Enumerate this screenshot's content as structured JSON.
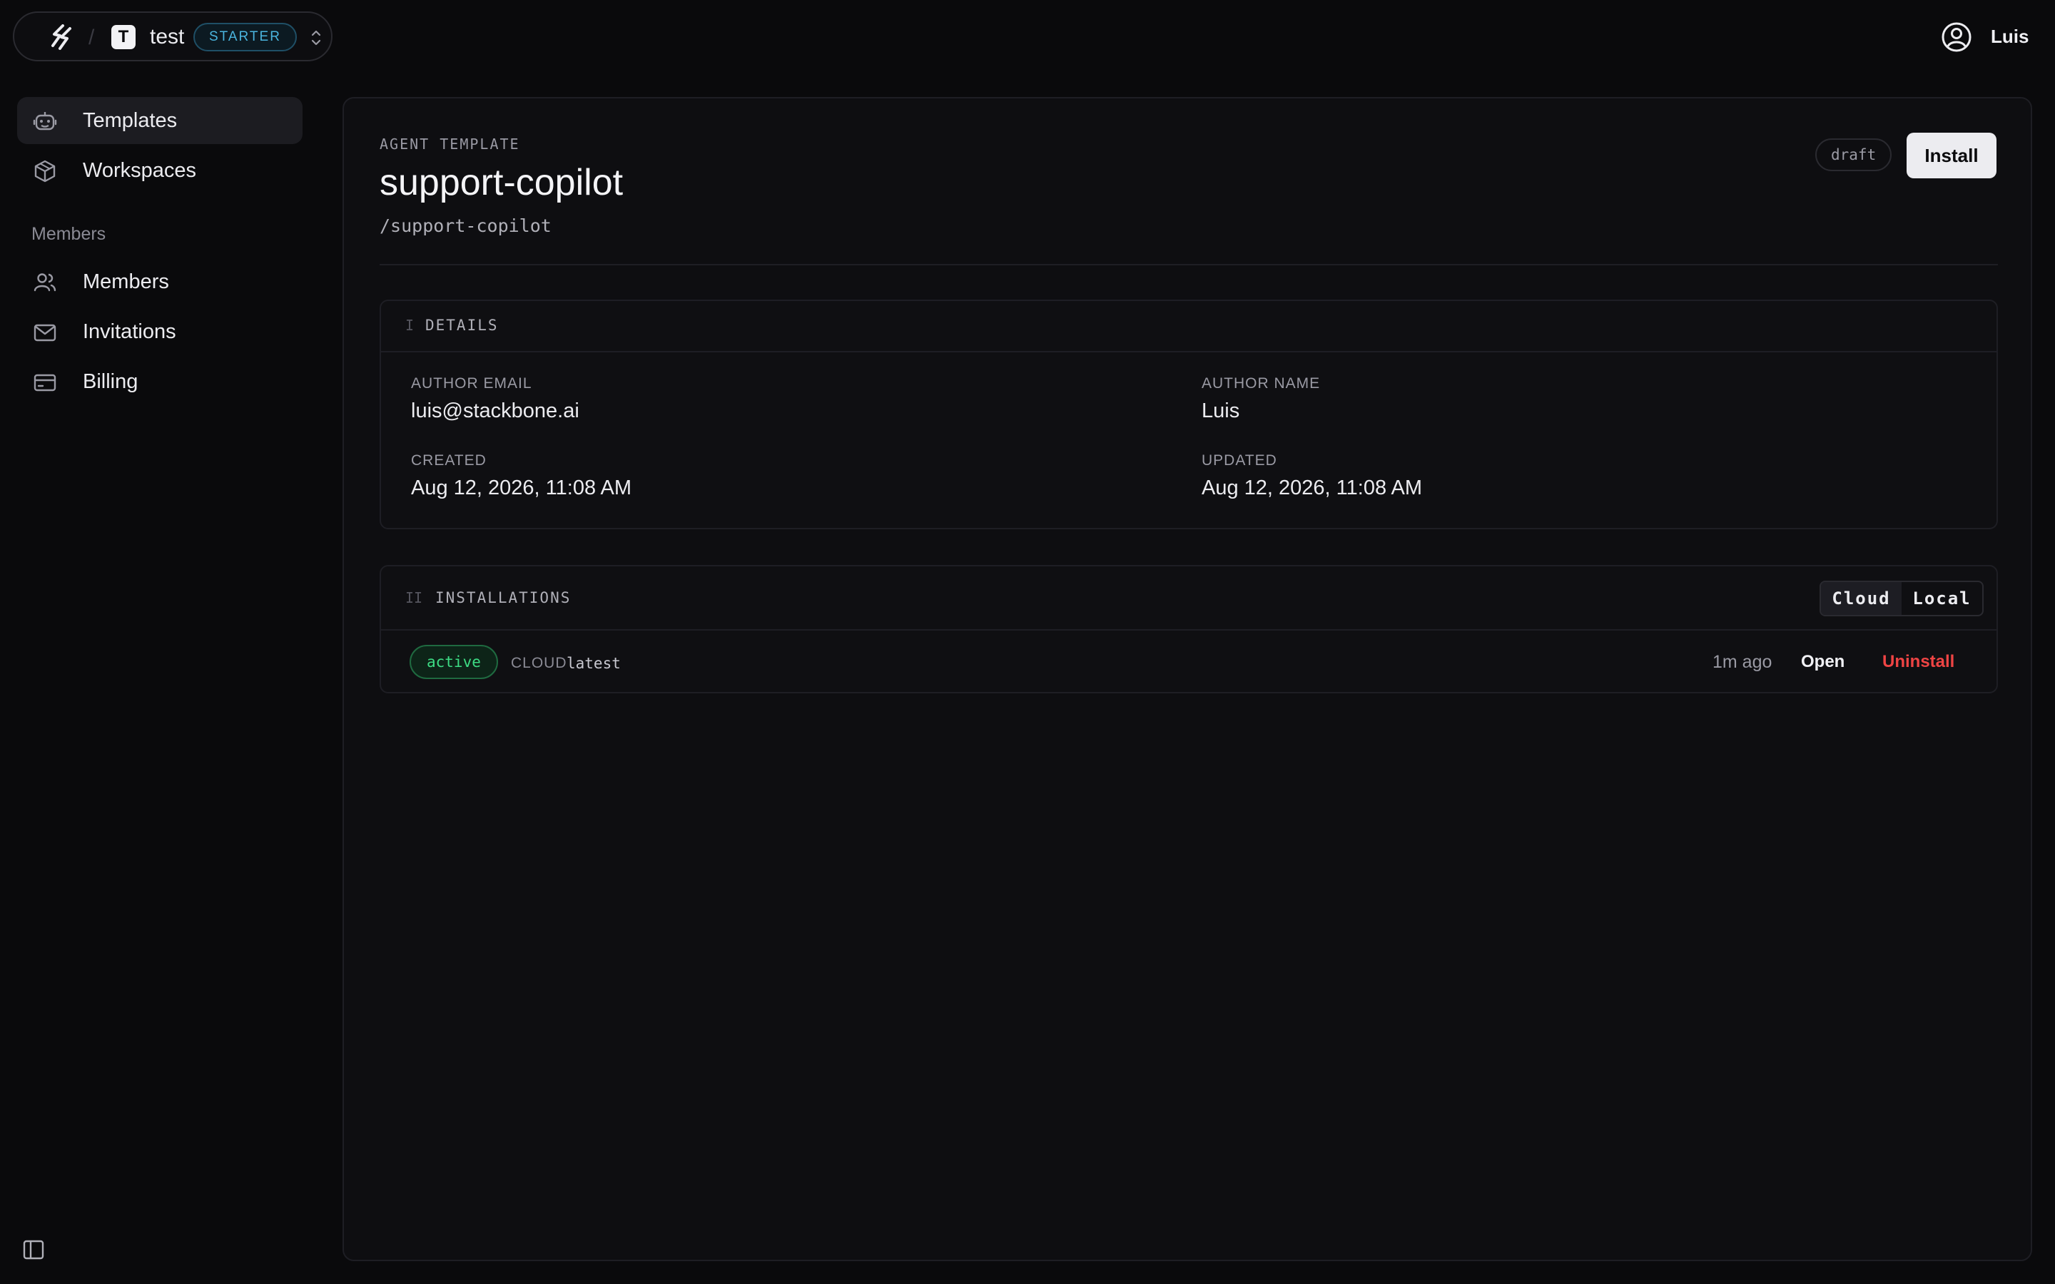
{
  "workspace": {
    "avatar_letter": "T",
    "name": "test",
    "plan": "STARTER",
    "separator": "/"
  },
  "user": {
    "name": "Luis"
  },
  "sidebar": {
    "items": [
      {
        "label": "Templates",
        "icon": "robot-icon",
        "active": true
      },
      {
        "label": "Workspaces",
        "icon": "cube-icon",
        "active": false
      }
    ],
    "section_label": "Members",
    "member_items": [
      {
        "label": "Members",
        "icon": "users-icon"
      },
      {
        "label": "Invitations",
        "icon": "mail-icon"
      },
      {
        "label": "Billing",
        "icon": "credit-card-icon"
      }
    ]
  },
  "template": {
    "eyebrow": "AGENT TEMPLATE",
    "title": "support-copilot",
    "slug": "/support-copilot",
    "status_badge": "draft",
    "install_label": "Install"
  },
  "details": {
    "numeral": "I",
    "title": "DETAILS",
    "fields": [
      {
        "label": "AUTHOR EMAIL",
        "value": "luis@stackbone.ai"
      },
      {
        "label": "AUTHOR NAME",
        "value": "Luis"
      },
      {
        "label": "CREATED",
        "value": "Aug 12, 2026, 11:08 AM"
      },
      {
        "label": "UPDATED",
        "value": "Aug 12, 2026, 11:08 AM"
      }
    ]
  },
  "installations": {
    "numeral": "II",
    "title": "INSTALLATIONS",
    "segments": [
      {
        "label": "Cloud",
        "active": true
      },
      {
        "label": "Local",
        "active": false
      }
    ],
    "rows": [
      {
        "status": "active",
        "environment": "CLOUD",
        "version": "latest",
        "time": "1m ago",
        "open_label": "Open",
        "uninstall_label": "Uninstall"
      }
    ]
  },
  "colors": {
    "background": "#0a0a0c",
    "panel": "#0e0e11",
    "plan_accent": "#4ab4de",
    "active_green": "#3ddc84",
    "danger_red": "#ef4444"
  }
}
